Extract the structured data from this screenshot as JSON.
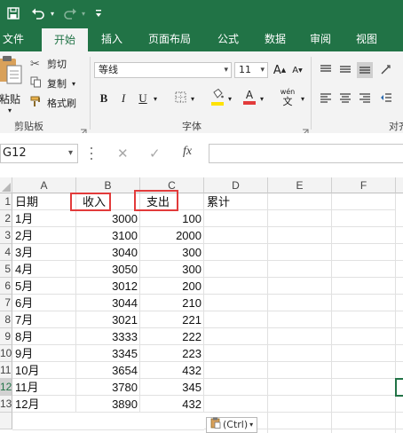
{
  "ribbon_tabs": [
    "文件",
    "开始",
    "插入",
    "页面布局",
    "公式",
    "数据",
    "审阅",
    "视图"
  ],
  "clipboard": {
    "paste_label": "粘贴",
    "cut_label": "剪切",
    "copy_label": "复制",
    "format_painter_label": "格式刷",
    "group_label": "剪贴板"
  },
  "font": {
    "name": "等线",
    "size": "11",
    "group_label": "字体",
    "bold_label": "B",
    "italic_label": "I",
    "underline_label": "U",
    "grow_label": "A",
    "shrink_label": "A",
    "wen_label": "wén",
    "wen_char": "文",
    "font_color_label": "A",
    "font_color": "#e23b3b",
    "fill_color": "#ffe200"
  },
  "alignment": {
    "group_label": "对齐"
  },
  "formula_bar": {
    "name_box": "G12",
    "fx_label": "fx",
    "formula": ""
  },
  "columns": [
    "A",
    "B",
    "C",
    "D",
    "E",
    "F"
  ],
  "row_numbers": [
    "1",
    "2",
    "3",
    "4",
    "5",
    "6",
    "7",
    "8",
    "9",
    "10",
    "11",
    "12",
    "13"
  ],
  "headers": {
    "a": "日期",
    "b": "收入",
    "c": "支出",
    "d": "累计"
  },
  "rows": [
    {
      "month": "1月",
      "income": "3000",
      "expense": "100"
    },
    {
      "month": "2月",
      "income": "3100",
      "expense": "2000"
    },
    {
      "month": "3月",
      "income": "3040",
      "expense": "300"
    },
    {
      "month": "4月",
      "income": "3050",
      "expense": "300"
    },
    {
      "month": "5月",
      "income": "3012",
      "expense": "200"
    },
    {
      "month": "6月",
      "income": "3044",
      "expense": "210"
    },
    {
      "month": "7月",
      "income": "3021",
      "expense": "221"
    },
    {
      "month": "8月",
      "income": "3333",
      "expense": "222"
    },
    {
      "month": "9月",
      "income": "3345",
      "expense": "223"
    },
    {
      "month": "10月",
      "income": "3654",
      "expense": "432"
    },
    {
      "month": "11月",
      "income": "3780",
      "expense": "345"
    },
    {
      "month": "12月",
      "income": "3890",
      "expense": "432"
    }
  ],
  "paste_options": {
    "label": "(Ctrl)"
  },
  "colors": {
    "brand": "#217346",
    "highlight_border": "#e23b3b"
  }
}
